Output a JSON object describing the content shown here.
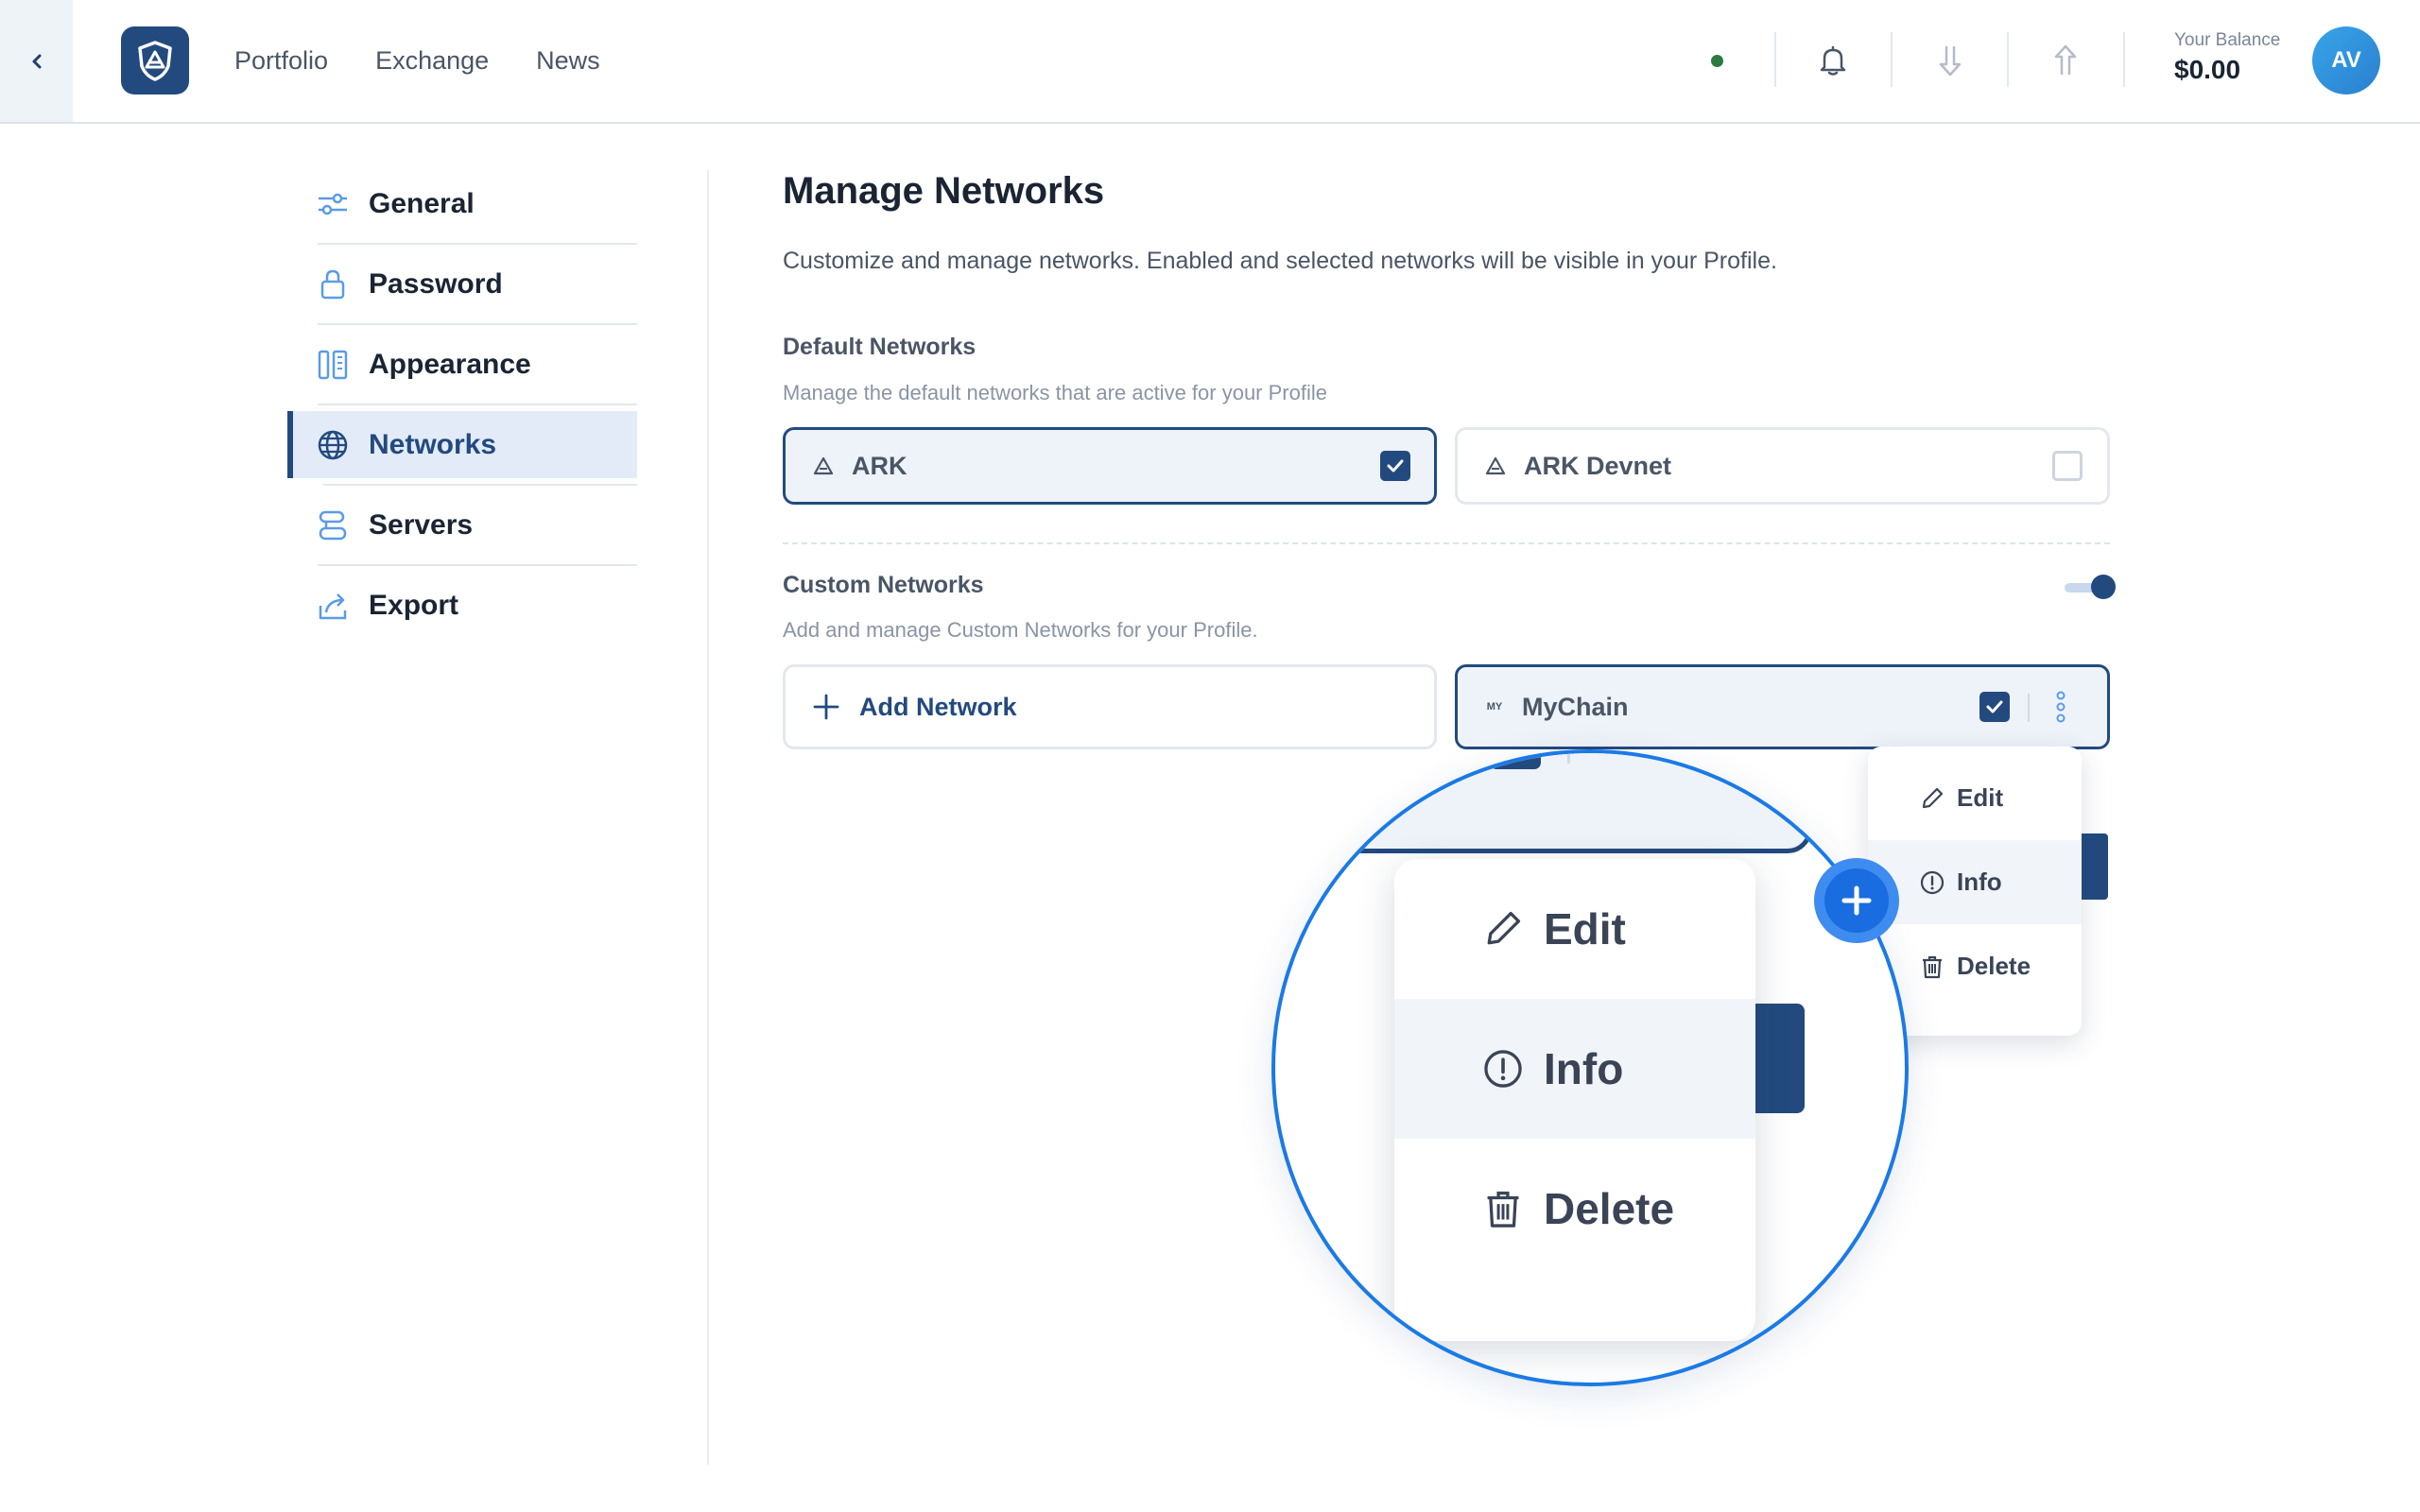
{
  "nav": {
    "back_icon": "chevron-left-icon",
    "logo_icon": "ark-shield-logo",
    "links": [
      "Portfolio",
      "Exchange",
      "News"
    ],
    "icons": [
      "bell-icon",
      "arrow-down-icon",
      "arrow-up-icon"
    ],
    "balance_label": "Your Balance",
    "balance_value": "$0.00",
    "avatar_initials": "AV",
    "status_color": "#2c7a3e"
  },
  "sidebar": {
    "items": [
      {
        "label": "General",
        "icon": "sliders-icon"
      },
      {
        "label": "Password",
        "icon": "lock-icon"
      },
      {
        "label": "Appearance",
        "icon": "appearance-icon"
      },
      {
        "label": "Networks",
        "icon": "globe-icon",
        "active": true
      },
      {
        "label": "Servers",
        "icon": "servers-icon"
      },
      {
        "label": "Export",
        "icon": "export-icon"
      }
    ]
  },
  "main": {
    "title": "Manage Networks",
    "subtitle": "Customize and manage networks. Enabled and selected networks will be visible in your Profile.",
    "default_networks": {
      "title": "Default Networks",
      "description": "Manage the default networks that are active for your Profile",
      "items": [
        {
          "label": "ARK",
          "checked": true
        },
        {
          "label": "ARK Devnet",
          "checked": false
        }
      ]
    },
    "custom_networks": {
      "title": "Custom Networks",
      "description": "Add and manage Custom Networks for your Profile.",
      "toggle_on": true,
      "add_label": "Add Network",
      "network": {
        "badge": "MY",
        "label": "MyChain",
        "checked": true
      }
    }
  },
  "dropdown": {
    "items": [
      {
        "label": "Edit",
        "icon": "pencil-icon"
      },
      {
        "label": "Info",
        "icon": "info-icon"
      },
      {
        "label": "Delete",
        "icon": "trash-icon"
      }
    ]
  },
  "colors": {
    "primary": "#234a7f",
    "magnifier_ring": "#1a7ae6",
    "badge": "#1a6de0"
  }
}
